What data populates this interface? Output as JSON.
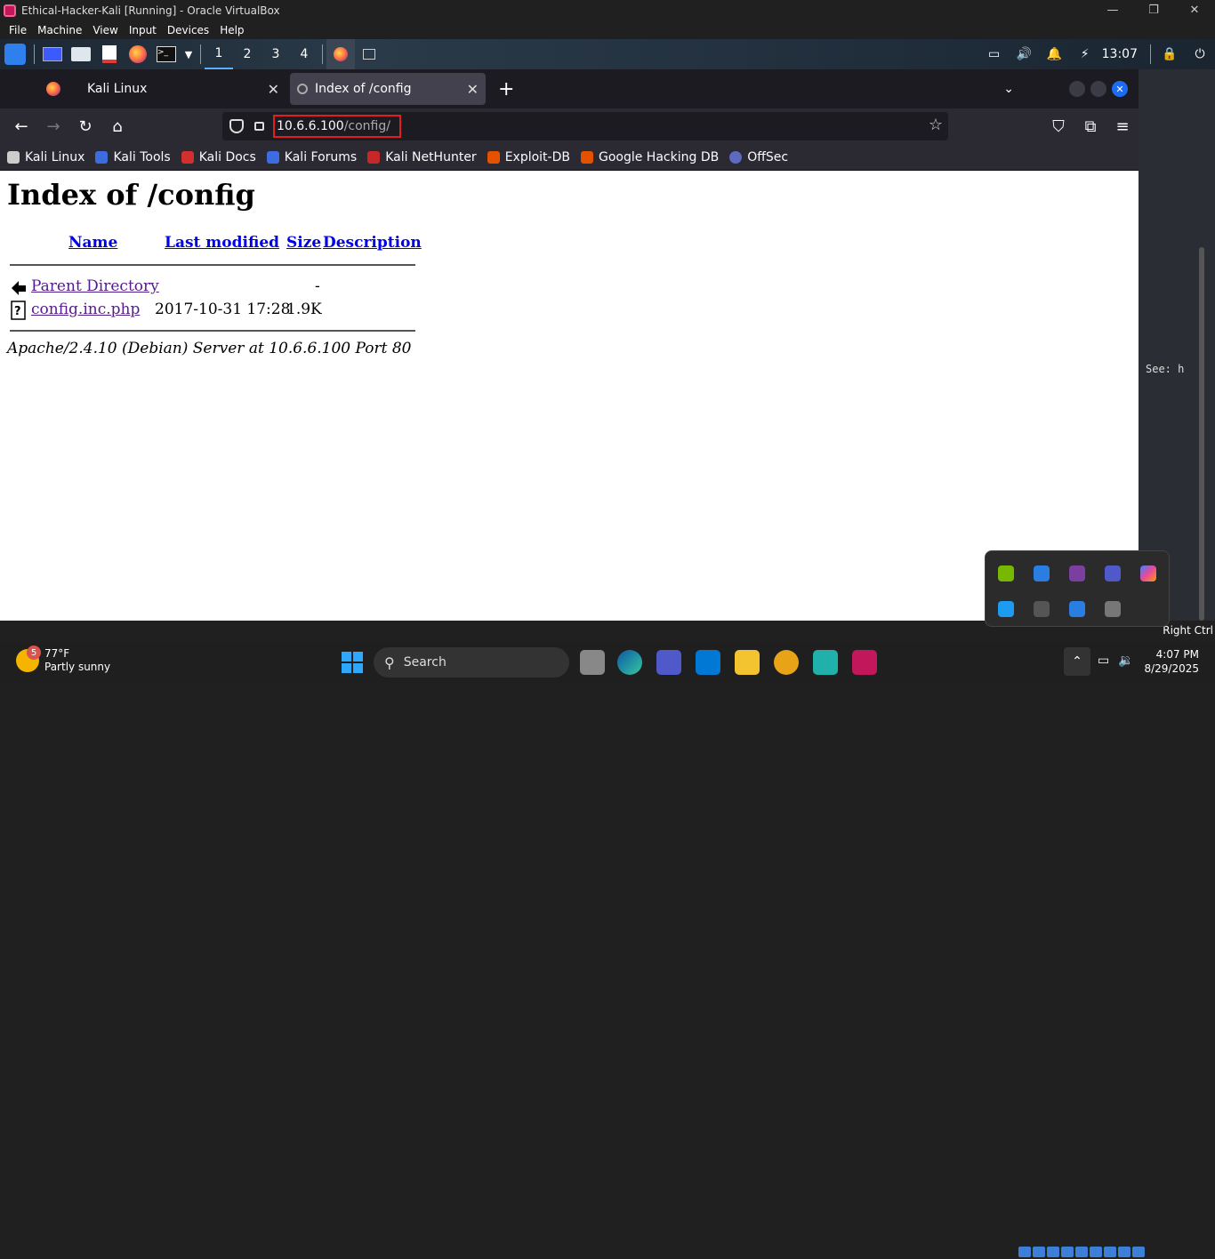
{
  "vbox": {
    "title": "Ethical-Hacker-Kali [Running] - Oracle VirtualBox",
    "menu": [
      "File",
      "Machine",
      "View",
      "Input",
      "Devices",
      "Help"
    ],
    "status_hostkey": "Right Ctrl"
  },
  "kali_panel": {
    "workspaces": [
      "1",
      "2",
      "3",
      "4"
    ],
    "active_workspace": "1",
    "time": "13:07"
  },
  "firefox": {
    "tabs": [
      {
        "title": "Kali Linux",
        "active": false
      },
      {
        "title": "Index of /config",
        "active": true
      }
    ],
    "url_host": "10.6.6.100",
    "url_path": "/config/",
    "bookmarks": [
      "Kali Linux",
      "Kali Tools",
      "Kali Docs",
      "Kali Forums",
      "Kali NetHunter",
      "Exploit-DB",
      "Google Hacking DB",
      "OffSec"
    ]
  },
  "page": {
    "heading": "Index of /config",
    "columns": [
      "Name",
      "Last modified",
      "Size",
      "Description"
    ],
    "rows": [
      {
        "name": "Parent Directory",
        "modified": "",
        "size": "-",
        "icon": "back-arrow-icon"
      },
      {
        "name": "config.inc.php",
        "modified": "2017-10-31 17:28",
        "size": "1.9K",
        "icon": "unknown-file-icon"
      }
    ],
    "server": "Apache/2.4.10 (Debian) Server at 10.6.6.100 Port 80"
  },
  "background_terminal_text": "See: h",
  "taskbar": {
    "weather_badge": "5",
    "temperature": "77°F",
    "condition": "Partly sunny",
    "search_placeholder": "Search",
    "time": "4:07 PM",
    "date": "8/29/2025"
  }
}
